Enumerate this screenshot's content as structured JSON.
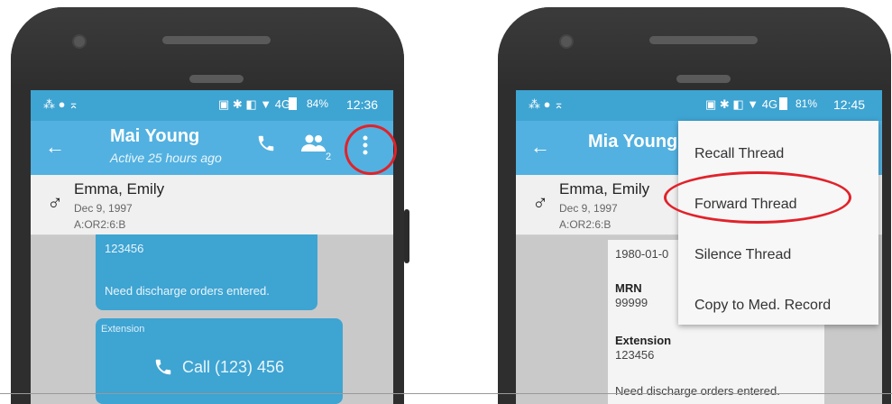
{
  "colors": {
    "statusbar": "#3ea4d2",
    "appbar": "#52b1e0",
    "highlight": "#e1222a"
  },
  "left": {
    "status": {
      "icons_left": "⁂ ● ⌅",
      "icons_right": "▣ ✱ ◧ ▼ 4G",
      "battery": "84%",
      "time": "12:36"
    },
    "header": {
      "title": "Mai Young",
      "subtitle": "Active 25 hours ago",
      "participants_count": "2"
    },
    "patient": {
      "name": "Emma, Emily",
      "dob": "Dec 9, 1997",
      "location": "A:OR2:6:B",
      "gender_symbol": "♂"
    },
    "message1": {
      "number": "123456",
      "text": "Need discharge orders entered."
    },
    "message2": {
      "label": "Extension",
      "call_text": "Call (123) 456"
    }
  },
  "right": {
    "status": {
      "icons_left": "⁂ ● ⌅",
      "icons_right": "▣ ✱ ◧ ▼ 4G",
      "battery": "81%",
      "time": "12:45"
    },
    "header": {
      "title": "Mia Young"
    },
    "patient": {
      "name": "Emma, Emily",
      "dob": "Dec 9, 1997",
      "location": "A:OR2:6:B",
      "gender_symbol": "♂"
    },
    "card": {
      "date": "1980-01-0",
      "mrn_label": "MRN",
      "mrn_value": "99999",
      "ext_label": "Extension",
      "ext_value": "123456",
      "text": "Need discharge orders entered."
    },
    "menu": [
      "Recall Thread",
      "Forward Thread",
      "Silence Thread",
      "Copy to Med. Record"
    ]
  }
}
